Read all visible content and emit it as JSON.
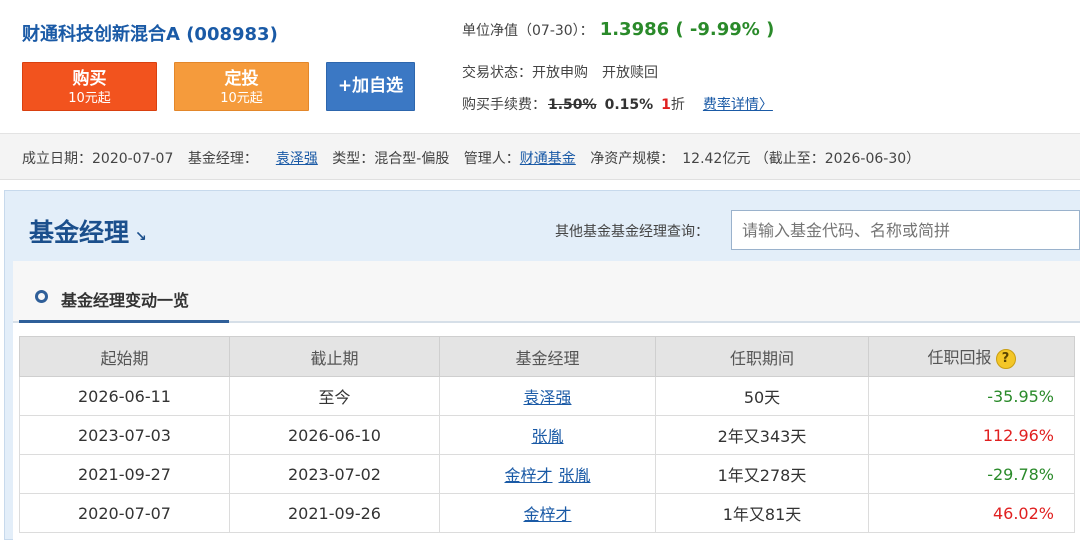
{
  "fund": {
    "title": "财通科技创新混合A (008983)",
    "buy": {
      "label": "购买",
      "sub": "10元起"
    },
    "fixed": {
      "label": "定投",
      "sub": "10元起"
    },
    "add_label": "+加自选",
    "nav_label": "单位净值（07-30）：",
    "nav_value": "1.3986 ( -9.99% )",
    "trade_label": "交易状态：",
    "trade_buy": "开放申购",
    "trade_redeem": "开放赎回",
    "fee_label": "购买手续费：",
    "fee_original": "1.50%",
    "fee_real": "0.15%",
    "fee_discount_num": "1",
    "fee_discount_unit": "折",
    "fee_link": "费率详情〉"
  },
  "info": {
    "found_label": "成立日期：",
    "found_date": "2020-07-07",
    "manager_label": "基金经理：",
    "manager": "袁泽强",
    "type_label": "类型：",
    "type": "混合型-偏股",
    "admin_label": "管理人：",
    "admin": "财通基金",
    "scale_label": "净资产规模：",
    "scale": "12.42亿元 （截止至：2026-06-30）"
  },
  "panel": {
    "title": "基金经理",
    "arrow": "↘",
    "query_label": "其他基金基金经理查询：",
    "query_placeholder": "请输入基金代码、名称或简拼",
    "sub_title": "基金经理变动一览"
  },
  "table": {
    "headers": [
      "起始期",
      "截止期",
      "基金经理",
      "任职期间",
      "任职回报"
    ],
    "help_icon": "?",
    "rows": [
      {
        "start": "2026-06-11",
        "end": "至今",
        "mgr1": "袁泽强",
        "mgr2": "",
        "period": "50天",
        "ret": "-35.95%"
      },
      {
        "start": "2023-07-03",
        "end": "2026-06-10",
        "mgr1": "张胤",
        "mgr2": "",
        "period": "2年又343天",
        "ret": "112.96%"
      },
      {
        "start": "2021-09-27",
        "end": "2023-07-02",
        "mgr1": "金梓才",
        "mgr2": "张胤",
        "period": "1年又278天",
        "ret": "-29.78%"
      },
      {
        "start": "2020-07-07",
        "end": "2021-09-26",
        "mgr1": "金梓才",
        "mgr2": "",
        "period": "1年又81天",
        "ret": "46.02%"
      }
    ]
  },
  "colors": {
    "up": "#e02020",
    "down": "#2a8a2a",
    "link": "#1a5aa6"
  }
}
